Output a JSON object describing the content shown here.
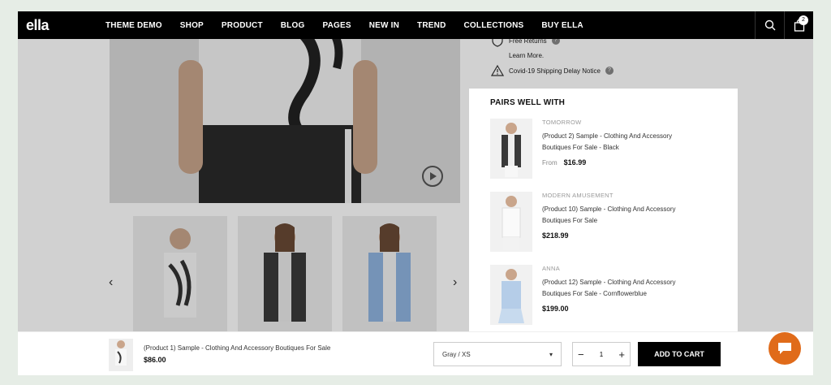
{
  "nav": {
    "logo": "ella",
    "menu": [
      "THEME DEMO",
      "SHOP",
      "PRODUCT",
      "BLOG",
      "PAGES",
      "NEW IN",
      "TREND",
      "COLLECTIONS",
      "BUY ELLA"
    ],
    "cart_count": "2"
  },
  "info": {
    "free_returns": "Free Returns",
    "learn_more": "Learn More.",
    "covid_notice": "Covid-19 Shipping Delay Notice"
  },
  "pairs": {
    "title": "PAIRS WELL WITH",
    "items": [
      {
        "vendor": "TOMORROW",
        "name": "(Product 2) Sample - Clothing And Accessory Boutiques For Sale - Black",
        "from": "From",
        "price": "$16.99"
      },
      {
        "vendor": "MODERN AMUSEMENT",
        "name": "(Product 10) Sample - Clothing And Accessory Boutiques For Sale",
        "from": "",
        "price": "$218.99"
      },
      {
        "vendor": "ANNA",
        "name": "(Product 12) Sample - Clothing And Accessory Boutiques For Sale - Cornflowerblue",
        "from": "",
        "price": "$199.00"
      }
    ]
  },
  "sticky": {
    "product_name": "(Product 1) Sample - Clothing And Accessory Boutiques For Sale",
    "price": "$86.00",
    "variant": "Gray / XS",
    "quantity": "1",
    "add_to_cart": "ADD TO CART"
  },
  "colors": {
    "accent": "#e06b1a",
    "nav_bg": "#000000"
  }
}
